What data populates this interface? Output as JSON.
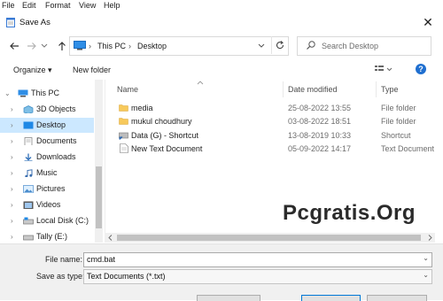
{
  "menubar": {
    "items": [
      "File",
      "Edit",
      "Format",
      "View",
      "Help"
    ]
  },
  "dialog": {
    "title": "Save As",
    "close": "✕"
  },
  "address": {
    "root": "This PC",
    "sep": "›",
    "folder": "Desktop",
    "dropdown": "⌄"
  },
  "search": {
    "placeholder": "Search Desktop"
  },
  "toolbar": {
    "organize": "Organize ▾",
    "new_folder": "New folder"
  },
  "nav": {
    "items": [
      {
        "label": "This PC",
        "arrow": "⌄"
      },
      {
        "label": "3D Objects",
        "arrow": "›"
      },
      {
        "label": "Desktop",
        "arrow": "›"
      },
      {
        "label": "Documents",
        "arrow": "›"
      },
      {
        "label": "Downloads",
        "arrow": "›"
      },
      {
        "label": "Music",
        "arrow": "›"
      },
      {
        "label": "Pictures",
        "arrow": "›"
      },
      {
        "label": "Videos",
        "arrow": "›"
      },
      {
        "label": "Local Disk (C:)",
        "arrow": "›"
      },
      {
        "label": "Tally (E:)",
        "arrow": "›"
      }
    ]
  },
  "columns": {
    "name": "Name",
    "date": "Date modified",
    "type": "Type"
  },
  "files": [
    {
      "name": "media",
      "date": "25-08-2022 13:55",
      "type": "File folder"
    },
    {
      "name": "mukul choudhury",
      "date": "03-08-2022 18:51",
      "type": "File folder"
    },
    {
      "name": "Data (G) - Shortcut",
      "date": "13-08-2019 10:33",
      "type": "Shortcut"
    },
    {
      "name": "New Text Document",
      "date": "05-09-2022 14:17",
      "type": "Text Document"
    }
  ],
  "watermark": "Pcgratis.Org",
  "filename": {
    "label": "File name:",
    "value": "cmd.bat"
  },
  "savetype": {
    "label": "Save as type:",
    "value": "Text Documents (*.txt)"
  },
  "colors": {
    "accent": "#0078d7",
    "selection": "#cce8ff",
    "folder": "#f7c95b",
    "help": "#1f6fd0"
  },
  "icons": [
    "notepad-icon",
    "back-arrow-icon",
    "forward-arrow-icon",
    "dropdown-icon",
    "up-arrow-icon",
    "pc-icon",
    "refresh-icon",
    "search-icon",
    "view-options-icon",
    "help-icon",
    "folder-icon",
    "shortcut-icon",
    "text-file-icon",
    "close-icon"
  ]
}
